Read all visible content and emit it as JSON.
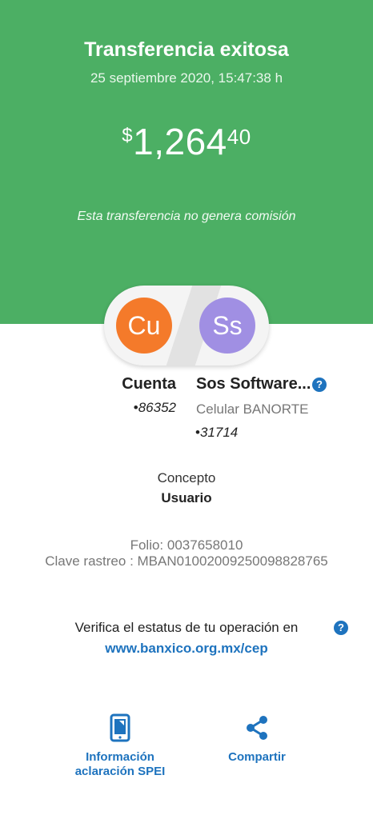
{
  "header": {
    "title": "Transferencia exitosa",
    "datetime": "25 septiembre 2020, 15:47:38 h",
    "amount": {
      "currency": "$",
      "whole": "1,264",
      "cents": "40"
    },
    "commission_note": "Esta transferencia no genera comisión"
  },
  "from": {
    "initials": "Cu",
    "name": "Cuenta",
    "account": "86352"
  },
  "to": {
    "initials": "Ss",
    "name": "Sos Software...",
    "bank": "Celular BANORTE",
    "account": "31714"
  },
  "concept": {
    "label": "Concepto",
    "value": "Usuario"
  },
  "folio": "Folio: 0037658010",
  "clave": "Clave rastreo : MBAN01002009250098828765",
  "verify": {
    "text": "Verifica el estatus de tu operación en",
    "link": "www.banxico.org.mx/cep"
  },
  "actions": {
    "spei_line1": "Información",
    "spei_line2": "aclaración SPEI",
    "share": "Compartir"
  },
  "colors": {
    "header_green": "#4caf64",
    "accent_blue": "#1e73be",
    "avatar_orange": "#f47a2a",
    "avatar_purple": "#a08fe3"
  },
  "icons": [
    "help-icon",
    "phone-document-icon",
    "share-icon"
  ]
}
